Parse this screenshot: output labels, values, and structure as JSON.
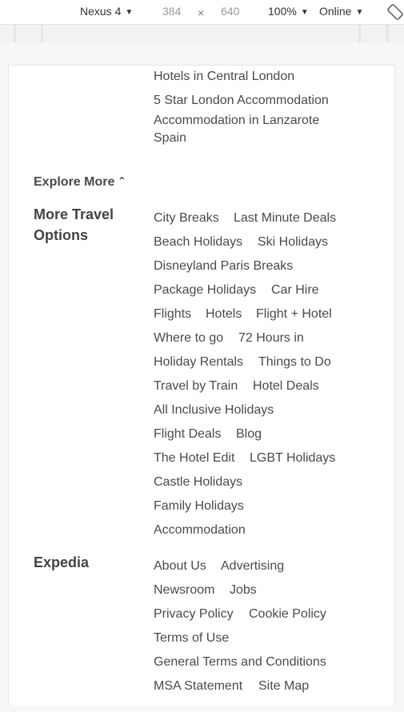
{
  "devtools": {
    "device": "Nexus 4",
    "width": "384",
    "times": "×",
    "height": "640",
    "zoom": "100%",
    "throttle": "Online"
  },
  "top_links": [
    "Hotels in Central London",
    "5 Star London Accommodation",
    "Accommodation in Lanzarote",
    "Spain"
  ],
  "explore_more": "Explore More",
  "travel_section": {
    "heading_line1": "More Travel",
    "heading_line2": "Options",
    "rows": [
      [
        "City Breaks",
        "Last Minute Deals"
      ],
      [
        "Beach Holidays",
        "Ski Holidays"
      ],
      [
        "Disneyland Paris Breaks"
      ],
      [
        "Package Holidays",
        "Car Hire"
      ],
      [
        "Flights",
        "Hotels",
        "Flight + Hotel"
      ],
      [
        "Where to go",
        "72 Hours in"
      ],
      [
        "Holiday Rentals",
        "Things to Do"
      ],
      [
        "Travel by Train",
        "Hotel Deals"
      ],
      [
        "All Inclusive Holidays"
      ],
      [
        "Flight Deals",
        "Blog"
      ],
      [
        "The Hotel Edit",
        "LGBT Holidays"
      ],
      [
        "Castle Holidays"
      ],
      [
        "Family Holidays"
      ],
      [
        "Accommodation"
      ]
    ]
  },
  "expedia_section": {
    "heading": "Expedia",
    "rows": [
      [
        "About Us",
        "Advertising"
      ],
      [
        "Newsroom",
        "Jobs"
      ],
      [
        "Privacy Policy",
        "Cookie Policy"
      ],
      [
        "Terms of Use"
      ],
      [
        "General Terms and Conditions"
      ],
      [
        "MSA Statement",
        "Site Map"
      ]
    ]
  }
}
